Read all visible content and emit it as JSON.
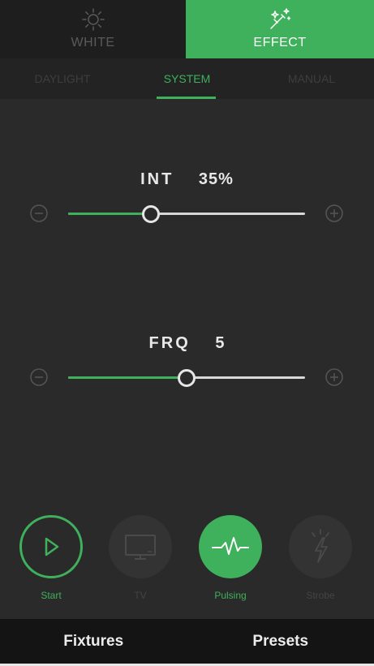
{
  "mode_tabs": [
    {
      "label": "WHITE",
      "icon": "sun-icon",
      "active": false
    },
    {
      "label": "EFFECT",
      "icon": "magic-wand-icon",
      "active": true
    }
  ],
  "sub_tabs": [
    {
      "label": "DAYLIGHT",
      "active": false
    },
    {
      "label": "SYSTEM",
      "active": true
    },
    {
      "label": "MANUAL",
      "active": false
    }
  ],
  "intensity": {
    "label": "INT",
    "value_text": "35%",
    "level": 0.35
  },
  "frequency": {
    "label": "FRQ",
    "value_text": "5",
    "level": 0.5
  },
  "effects": [
    {
      "label": "Start",
      "icon": "play-icon",
      "state": "outline"
    },
    {
      "label": "TV",
      "icon": "tv-icon",
      "state": "disabled"
    },
    {
      "label": "Pulsing",
      "icon": "pulse-icon",
      "state": "active"
    },
    {
      "label": "Strobe",
      "icon": "lightning-icon",
      "state": "disabled"
    }
  ],
  "bottom_nav": {
    "fixtures": "Fixtures",
    "presets": "Presets"
  },
  "colors": {
    "accent": "#3fb05b",
    "background": "#2a2a2a",
    "header": "#1e1e1e",
    "bottom_bar": "#141414"
  }
}
